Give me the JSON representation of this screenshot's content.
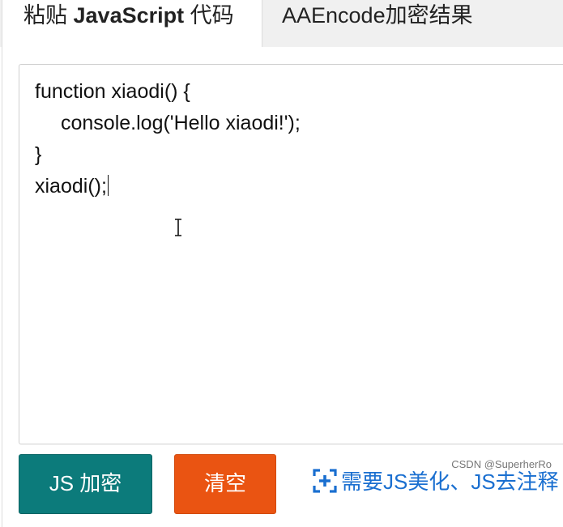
{
  "tabs": {
    "paste_prefix": "粘贴 ",
    "paste_bold": "JavaScript",
    "paste_suffix": " 代码",
    "result": "AAEncode加密结果"
  },
  "editor": {
    "lines": [
      "function xiaodi() {",
      "console.log('Hello xiaodi!');",
      "}",
      "xiaodi();"
    ]
  },
  "buttons": {
    "encrypt": "JS 加密",
    "clear": "清空"
  },
  "link": {
    "beautify": "需要JS美化、JS去注释"
  },
  "watermark": "CSDN @SuperherRo",
  "colors": {
    "encrypt_button": "#0c7b7b",
    "clear_button": "#ea5412",
    "link": "#1a6fd0"
  }
}
